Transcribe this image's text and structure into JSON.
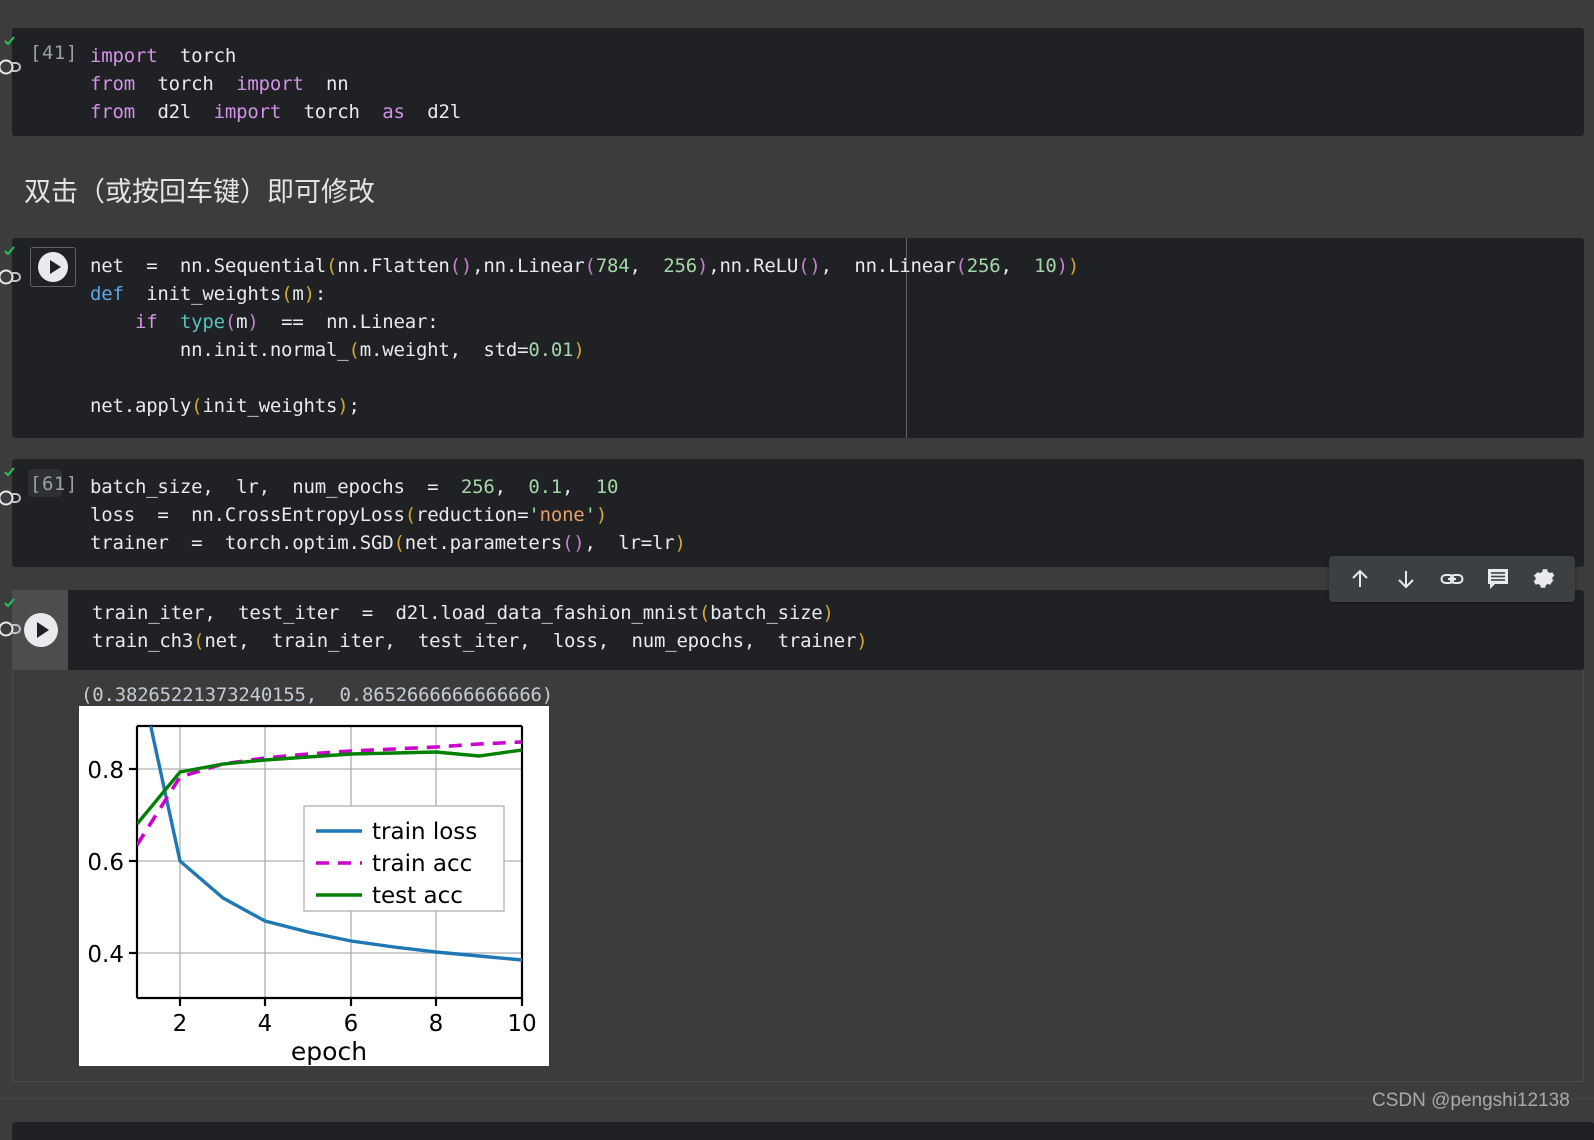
{
  "cells": [
    {
      "id": "cell-import",
      "exec_label": "[41]",
      "lines": [
        "import  torch",
        "from  torch  import  nn",
        "from  d2l  import  torch  as  d2l"
      ]
    },
    {
      "id": "cell-markdown",
      "text": "双击（或按回车键）即可修改"
    },
    {
      "id": "cell-net",
      "exec_label": "",
      "lines": [
        "net  =  nn.Sequential(nn.Flatten(),nn.Linear(784,  256),nn.ReLU(),  nn.Linear(256,  10))",
        "def  init_weights(m):",
        "    if  type(m)  ==  nn.Linear:",
        "        nn.init.normal_(m.weight,  std=0.01)",
        "",
        "net.apply(init_weights);"
      ]
    },
    {
      "id": "cell-hparams",
      "exec_label": "[61]",
      "lines": [
        "batch_size,  lr,  num_epochs  =  256,  0.1,  10",
        "loss  =  nn.CrossEntropyLoss(reduction='none')",
        "trainer  =  torch.optim.SGD(net.parameters(),  lr=lr)"
      ]
    },
    {
      "id": "cell-train",
      "exec_label": "",
      "lines": [
        "train_iter,  test_iter  =  d2l.load_data_fashion_mnist(batch_size)",
        "train_ch3(net,  train_iter,  test_iter,  loss,  num_epochs,  trainer)"
      ]
    }
  ],
  "output": {
    "text": "(0.38265221373240155,  0.8652666666666666)"
  },
  "toolbar": {
    "buttons": [
      {
        "name": "move-cell-up-icon",
        "label": "Move cell up"
      },
      {
        "name": "move-cell-down-icon",
        "label": "Move cell down"
      },
      {
        "name": "link-icon",
        "label": "Link to cell"
      },
      {
        "name": "comment-icon",
        "label": "Add a comment"
      },
      {
        "name": "gear-icon",
        "label": "Cell settings"
      }
    ]
  },
  "watermark": {
    "text": "CSDN @pengshi12138"
  },
  "colors": {
    "background": "#3c3c3c",
    "cell_background": "#202124",
    "train_loss": "#1f77b4",
    "train_acc": "#cc00cc",
    "test_acc": "#008000",
    "code_text": "#e8eaed",
    "exec_label": "#9aa0a6"
  },
  "chart_data": {
    "type": "line",
    "title": "",
    "xlabel": "epoch",
    "ylabel": "",
    "xlim": [
      1,
      10
    ],
    "ylim": [
      0.3,
      0.9
    ],
    "xticks": [
      2,
      4,
      6,
      8,
      10
    ],
    "yticks": [
      0.4,
      0.6,
      0.8
    ],
    "grid": true,
    "legend_position": "center right",
    "x": [
      1,
      2,
      3,
      4,
      5,
      6,
      7,
      8,
      9,
      10
    ],
    "series": [
      {
        "name": "train loss",
        "color": "#1f77b4",
        "style": "solid",
        "values": [
          1.04,
          0.6,
          0.52,
          0.47,
          0.445,
          0.425,
          0.412,
          0.4,
          0.391,
          0.383
        ]
      },
      {
        "name": "train acc",
        "color": "#cc00cc",
        "style": "dashed",
        "values": [
          0.637,
          0.788,
          0.817,
          0.829,
          0.838,
          0.845,
          0.85,
          0.855,
          0.86,
          0.865
        ]
      },
      {
        "name": "test acc",
        "color": "#008000",
        "style": "solid",
        "values": [
          0.684,
          0.798,
          0.815,
          0.825,
          0.832,
          0.838,
          0.841,
          0.843,
          0.834,
          0.846
        ]
      }
    ]
  }
}
